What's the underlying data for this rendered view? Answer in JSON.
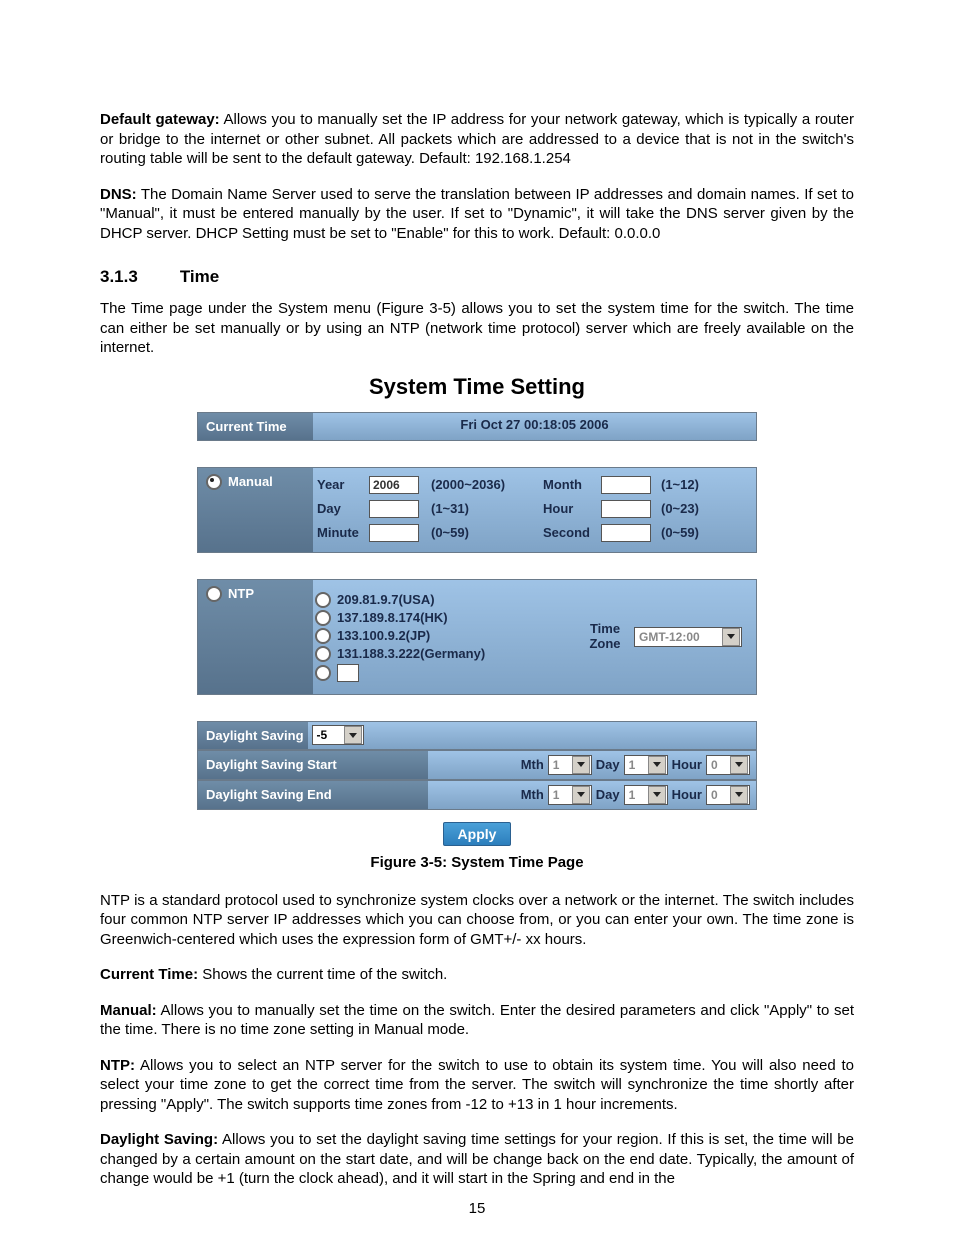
{
  "paragraphs": {
    "default_gateway_label": "Default gateway:",
    "default_gateway_text": " Allows you to manually set the IP address for your network gateway, which is typically a router or bridge to the internet or other subnet. All packets which are addressed to a device that is not in the switch's routing table will be sent to the default gateway. Default: 192.168.1.254",
    "dns_label": "DNS:",
    "dns_text": " The Domain Name Server used to serve the translation between IP addresses and domain names. If set to \"Manual\", it must be entered manually by the user. If set to \"Dynamic\", it will take the DNS server given by the DHCP server. DHCP Setting must be set to \"Enable\" for this to work. Default: 0.0.0.0",
    "time_intro": "The Time page under the System menu (Figure 3-5) allows you to set the system time for the switch. The time can either be set manually or by using an NTP (network time protocol) server which are freely available on the internet.",
    "ntp_intro": "NTP is a standard protocol used to synchronize system clocks over a network or the internet. The switch includes four common NTP server IP addresses which you can choose from, or you can enter your own. The time zone is Greenwich-centered which uses the expression form of GMT+/- xx hours.",
    "current_time_label": "Current Time:",
    "current_time_text": " Shows the current time of the switch.",
    "manual_label": "Manual:",
    "manual_text": " Allows you to manually set the time on the switch. Enter the desired parameters and click \"Apply\" to set the time. There is no time zone setting in Manual mode.",
    "ntp_label": "NTP:",
    "ntp_text": " Allows you to select an NTP server for the switch to use to obtain its system time. You will also need to select your time zone to get the correct time from the server. The switch will synchronize the time shortly after pressing \"Apply\". The switch supports time zones from -12 to +13 in 1 hour increments.",
    "ds_label": "Daylight Saving:",
    "ds_text": " Allows you to set the daylight saving time settings for your region. If this is set, the time will be changed by a certain amount on the start date, and will be change back on the end date. Typically, the amount of change would be +1 (turn the clock ahead), and it will start in the Spring and end in the"
  },
  "section": {
    "number": "3.1.3",
    "title": "Time"
  },
  "figure": {
    "title": "System Time Setting",
    "caption": "Figure 3-5: System Time Page",
    "current_time_label": "Current Time",
    "current_time_value": "Fri Oct 27 00:18:05 2006",
    "manual": {
      "label": "Manual",
      "year_label": "Year",
      "year_value": "2006",
      "year_hint": "(2000~2036)",
      "month_label": "Month",
      "month_value": "",
      "month_hint": "(1~12)",
      "day_label": "Day",
      "day_value": "",
      "day_hint": "(1~31)",
      "hour_label": "Hour",
      "hour_value": "",
      "hour_hint": "(0~23)",
      "minute_label": "Minute",
      "minute_value": "",
      "minute_hint": "(0~59)",
      "second_label": "Second",
      "second_value": "",
      "second_hint": "(0~59)"
    },
    "ntp": {
      "label": "NTP",
      "servers": [
        "209.81.9.7(USA)",
        "137.189.8.174(HK)",
        "133.100.9.2(JP)",
        "131.188.3.222(Germany)"
      ],
      "custom_value": "",
      "tz_label_line1": "Time",
      "tz_label_line2": "Zone",
      "tz_value": "GMT-12:00"
    },
    "daylight": {
      "offset_label": "Daylight Saving",
      "offset_value": "-5",
      "start_label": "Daylight Saving Start",
      "end_label": "Daylight Saving End",
      "mth_label": "Mth",
      "day_label": "Day",
      "hour_label": "Hour",
      "start_month": "1",
      "start_day": "1",
      "start_hour": "0",
      "end_month": "1",
      "end_day": "1",
      "end_hour": "0"
    },
    "apply_label": "Apply"
  },
  "page_number": "15"
}
